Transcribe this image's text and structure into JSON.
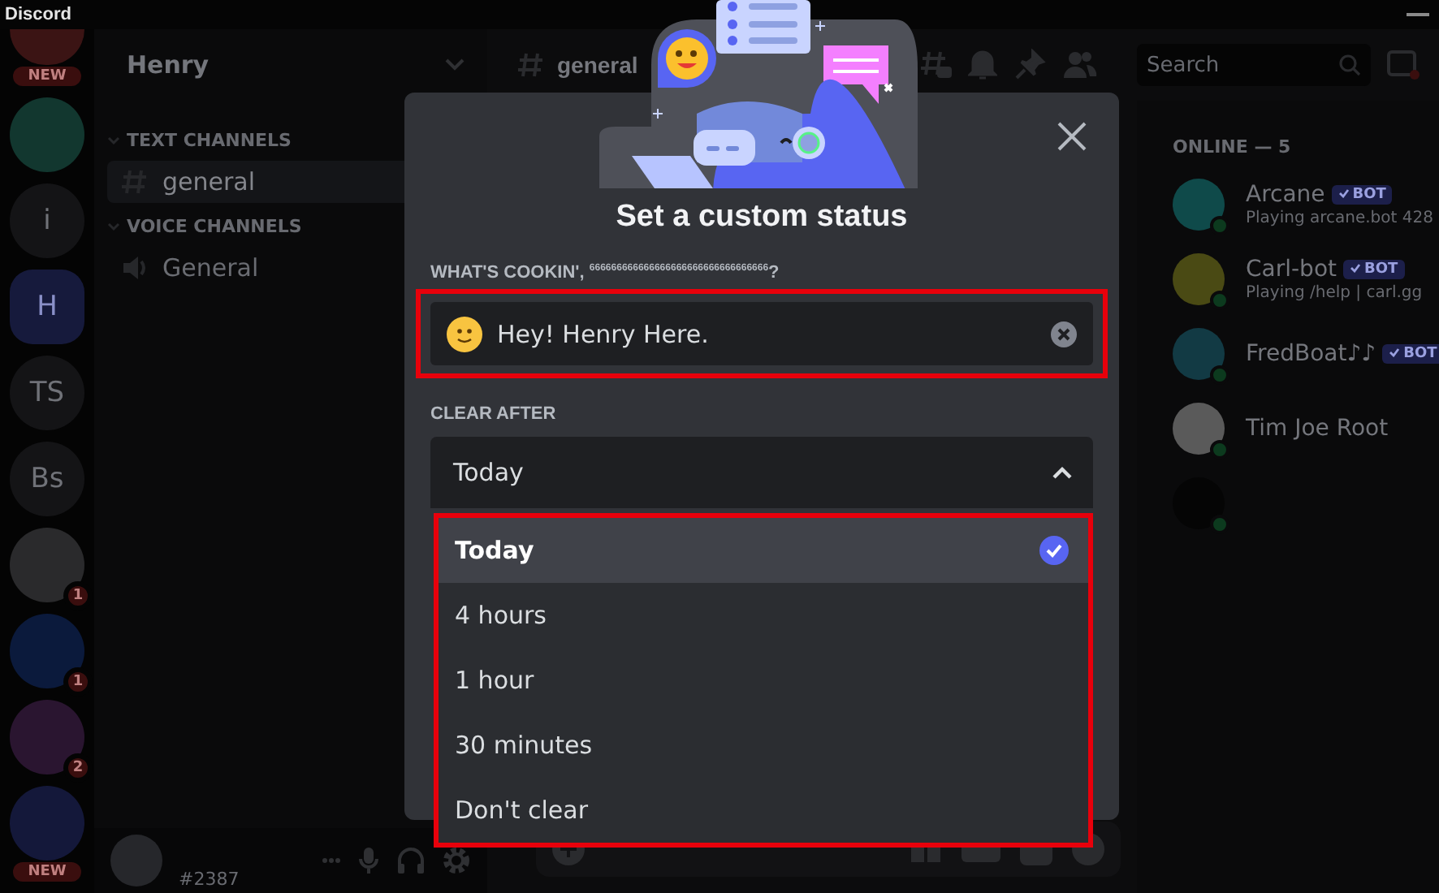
{
  "app": {
    "title": "Discord"
  },
  "servers": [
    {
      "kind": "cut",
      "color": "#3b1414",
      "badge": "NEW",
      "selected": false
    },
    {
      "kind": "image",
      "color": "#12372f",
      "selected": false
    },
    {
      "kind": "text",
      "label": "i",
      "selected": false
    },
    {
      "kind": "text",
      "label": "H",
      "selected": true
    },
    {
      "kind": "text",
      "label": "TS",
      "selected": false
    },
    {
      "kind": "text",
      "label": "Bs",
      "selected": false
    },
    {
      "kind": "image",
      "color": "#2a2a2c",
      "count": "1",
      "selected": false
    },
    {
      "kind": "image",
      "color": "#0b1a3c",
      "count": "1",
      "selected": false
    },
    {
      "kind": "image",
      "color": "#2a1530",
      "count": "2",
      "selected": false
    },
    {
      "kind": "image",
      "color": "#14183a",
      "badge": "NEW",
      "selected": false
    }
  ],
  "sidebar": {
    "server_name": "Henry",
    "categories": [
      {
        "name": "TEXT CHANNELS",
        "expanded": true,
        "channels": [
          {
            "name": "general",
            "kind": "text",
            "selected": true
          }
        ]
      },
      {
        "name": "VOICE CHANNELS",
        "expanded": true,
        "channels": [
          {
            "name": "General",
            "kind": "voice",
            "selected": false
          }
        ]
      }
    ],
    "user": {
      "tag": "#2387"
    }
  },
  "header": {
    "channel": "general",
    "search": {
      "placeholder": "Search"
    }
  },
  "members": {
    "heading": "ONLINE — 5",
    "items": [
      {
        "name": "Arcane",
        "bot": true,
        "bot_label": "BOT",
        "activity": "Playing arcane.bot 428",
        "color": "#0f4a4a"
      },
      {
        "name": "Carl-bot",
        "bot": true,
        "bot_label": "BOT",
        "activity": "Playing /help | carl.gg",
        "color": "#4a4a14"
      },
      {
        "name": "FredBoat♪♪",
        "bot": true,
        "bot_label": "BOT",
        "color": "#123a44"
      },
      {
        "name": "Tim Joe Root",
        "bot": false,
        "color": "#5a5a5a"
      },
      {
        "bot": false,
        "color": "#050505"
      }
    ]
  },
  "modal": {
    "title": "Set a custom status",
    "status_label": "WHAT'S COOKIN', $^{666666666666666666666666666666666}$?",
    "status_value": "Hey! Henry Here.",
    "clear_label": "CLEAR AFTER",
    "clear_after": {
      "value": "Today",
      "expanded": true,
      "options": [
        {
          "label": "Today",
          "selected": true
        },
        {
          "label": "4 hours",
          "selected": false
        },
        {
          "label": "1 hour",
          "selected": false
        },
        {
          "label": "30 minutes",
          "selected": false
        },
        {
          "label": "Don't clear",
          "selected": false
        }
      ]
    }
  }
}
